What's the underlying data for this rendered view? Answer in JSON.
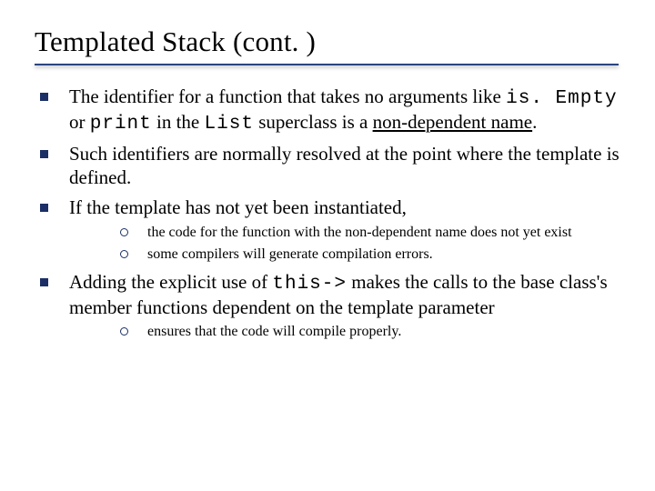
{
  "title": "Templated Stack (cont. )",
  "bullets": [
    {
      "parts": [
        {
          "t": "The identifier for a function that takes no arguments like "
        },
        {
          "t": "is. Empty",
          "cls": "code"
        },
        {
          "t": " or "
        },
        {
          "t": "print",
          "cls": "code"
        },
        {
          "t": " in the "
        },
        {
          "t": "List",
          "cls": "code"
        },
        {
          "t": " superclass is a "
        },
        {
          "t": "non-dependent name",
          "cls": "udl"
        },
        {
          "t": "."
        }
      ]
    },
    {
      "parts": [
        {
          "t": "Such identifiers are normally resolved at the point where the template is defined."
        }
      ]
    },
    {
      "parts": [
        {
          "t": "If the template has not yet been instantiated,"
        }
      ],
      "sub": [
        {
          "parts": [
            {
              "t": "the code for the function with the non-dependent name does not yet exist"
            }
          ]
        },
        {
          "parts": [
            {
              "t": "some compilers will generate compilation errors."
            }
          ]
        }
      ]
    },
    {
      "parts": [
        {
          "t": "Adding the explicit use of "
        },
        {
          "t": "this->",
          "cls": "code"
        },
        {
          "t": " makes the calls to the base class's member functions dependent on the template parameter"
        }
      ],
      "sub": [
        {
          "parts": [
            {
              "t": "ensures that the code will compile properly."
            }
          ]
        }
      ]
    }
  ]
}
